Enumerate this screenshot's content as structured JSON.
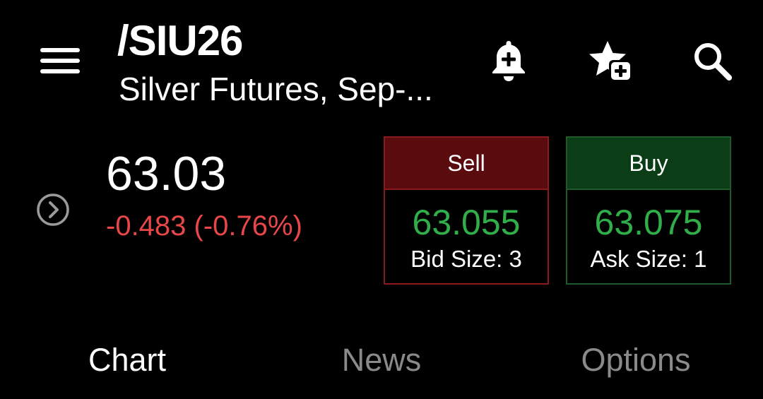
{
  "header": {
    "symbol": "/SIU26",
    "description": "Silver Futures, Sep-...",
    "icons": {
      "menu": "menu-icon",
      "alert": "bell-plus-icon",
      "watchlist": "star-plus-icon",
      "search": "search-icon"
    }
  },
  "quote": {
    "last": "63.03",
    "net_change": "-0.483 (-0.76%)",
    "expand_icon": "chevron-right-circle-icon"
  },
  "sell": {
    "label": "Sell",
    "price": "63.055",
    "size": "Bid Size: 3"
  },
  "buy": {
    "label": "Buy",
    "price": "63.075",
    "size": "Ask Size: 1"
  },
  "tabs": [
    {
      "label": "Chart",
      "active": true
    },
    {
      "label": "News",
      "active": false
    },
    {
      "label": "Options",
      "active": false
    }
  ],
  "colors": {
    "background": "#000000",
    "text": "#ffffff",
    "negative": "#e8474a",
    "positive": "#2fae4a",
    "sell_header": "#5a0b0e",
    "sell_border": "#8a1a1d",
    "buy_header": "#0b3d17",
    "buy_border": "#1c5a2a",
    "tab_inactive": "#8a8a8a",
    "icon_muted": "#9a9a9a"
  }
}
